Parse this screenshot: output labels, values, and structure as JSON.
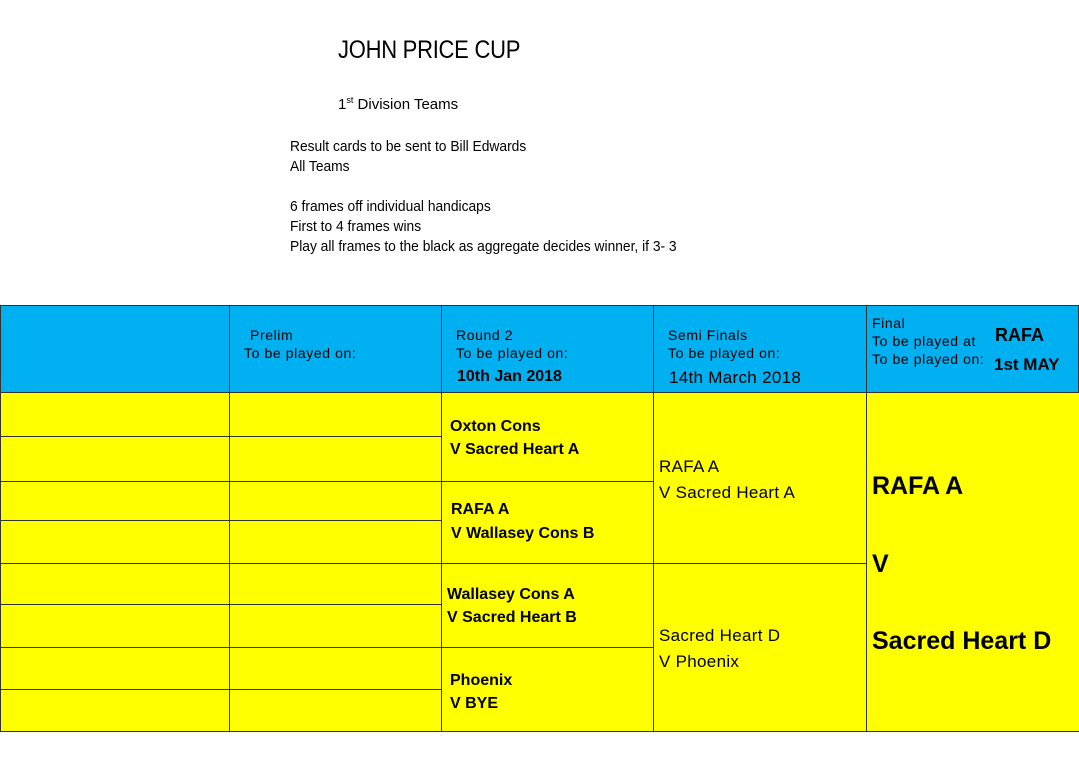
{
  "title": "JOHN PRICE CUP",
  "subtitle": {
    "ordinal": "1",
    "suffix": "st",
    "text": " Division Teams"
  },
  "notes": [
    "Result cards to be sent to Bill Edwards",
    "All Teams",
    "6 frames off individual handicaps",
    "First to 4 frames wins",
    "Play all frames to the black as aggregate decides winner, if 3- 3"
  ],
  "headers": {
    "prelim": {
      "label": "Prelim",
      "played_on": "To be played on:"
    },
    "round2": {
      "label": "Round 2",
      "played_on": "To be played on:",
      "date": "10th Jan 2018"
    },
    "semis": {
      "label": "Semi Finals",
      "played_on": "To be played on:",
      "date": "14th March 2018"
    },
    "final": {
      "label": "Final",
      "played_at": "To be played at",
      "venue": "RAFA",
      "played_on": "To be played on:",
      "date": "1st MAY"
    }
  },
  "round2_matches": [
    {
      "home": "Oxton Cons",
      "away": "V Sacred Heart A"
    },
    {
      "home": "RAFA A",
      "away": "V Wallasey Cons B"
    },
    {
      "home": "Wallasey Cons A",
      "away": "V Sacred Heart B"
    },
    {
      "home": "Phoenix",
      "away": "V BYE"
    }
  ],
  "semi_matches": [
    {
      "home": "RAFA A",
      "away": "V Sacred Heart A"
    },
    {
      "home": "Sacred Heart D",
      "away": "V Phoenix"
    }
  ],
  "final_match": {
    "home": "RAFA A",
    "vs": "V",
    "away": "Sacred Heart D"
  },
  "colors": {
    "header_bg": "#00b0f0",
    "cell_bg": "#ffff00"
  }
}
